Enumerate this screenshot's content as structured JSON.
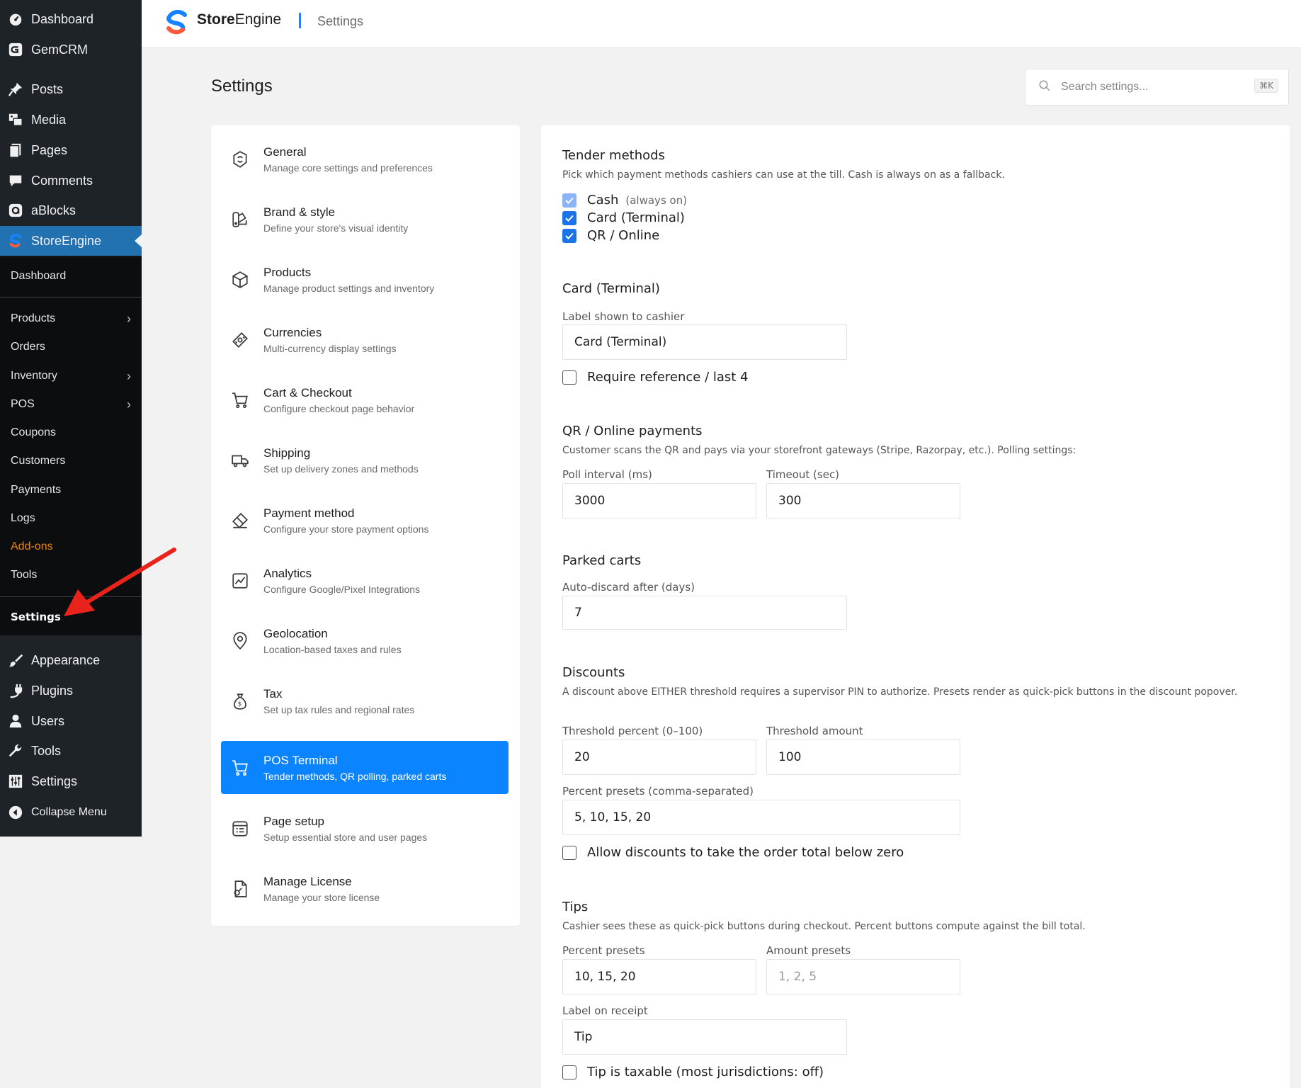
{
  "wp_menu": {
    "items": [
      {
        "label": "Dashboard",
        "icon": "dashboard-icon"
      },
      {
        "label": "GemCRM",
        "icon": "gemcrm-icon"
      },
      {
        "label": "Posts",
        "icon": "pin-icon"
      },
      {
        "label": "Media",
        "icon": "media-icon"
      },
      {
        "label": "Pages",
        "icon": "pages-icon"
      },
      {
        "label": "Comments",
        "icon": "comments-icon"
      },
      {
        "label": "aBlocks",
        "icon": "ablocks-icon"
      },
      {
        "label": "StoreEngine",
        "icon": "storeengine-icon"
      }
    ],
    "storeengine_submenu": [
      {
        "label": "Dashboard",
        "has_arrow": false
      },
      {
        "label": "Products",
        "has_arrow": true
      },
      {
        "label": "Orders",
        "has_arrow": false
      },
      {
        "label": "Inventory",
        "has_arrow": true
      },
      {
        "label": "POS",
        "has_arrow": true
      },
      {
        "label": "Coupons",
        "has_arrow": false
      },
      {
        "label": "Customers",
        "has_arrow": false
      },
      {
        "label": "Payments",
        "has_arrow": false
      },
      {
        "label": "Logs",
        "has_arrow": false
      },
      {
        "label": "Add-ons",
        "has_arrow": false,
        "color": "#f18500"
      },
      {
        "label": "Tools",
        "has_arrow": false
      },
      {
        "label": "Settings",
        "has_arrow": false,
        "active": true
      }
    ],
    "bottom_items": [
      {
        "label": "Appearance",
        "icon": "brush-icon"
      },
      {
        "label": "Plugins",
        "icon": "plugin-icon"
      },
      {
        "label": "Users",
        "icon": "users-icon"
      },
      {
        "label": "Tools",
        "icon": "wrench-icon"
      },
      {
        "label": "Settings",
        "icon": "settings-sliders-icon"
      },
      {
        "label": "Collapse Menu",
        "icon": "collapse-icon"
      }
    ]
  },
  "header": {
    "brand_bold": "Store",
    "brand_rest": "Engine",
    "breadcrumb": "Settings"
  },
  "page": {
    "title": "Settings",
    "search_placeholder": "Search settings...",
    "search_shortcut": "⌘K"
  },
  "settings_nav": [
    {
      "title": "General",
      "desc": "Manage core settings and preferences",
      "icon": "general-icon"
    },
    {
      "title": "Brand & style",
      "desc": "Define your store's visual identity",
      "icon": "brand-style-icon"
    },
    {
      "title": "Products",
      "desc": "Manage product settings and inventory",
      "icon": "box-icon"
    },
    {
      "title": "Currencies",
      "desc": "Multi-currency display settings",
      "icon": "currency-icon"
    },
    {
      "title": "Cart & Checkout",
      "desc": "Configure checkout page behavior",
      "icon": "cart-icon"
    },
    {
      "title": "Shipping",
      "desc": "Set up delivery zones and methods",
      "icon": "truck-icon"
    },
    {
      "title": "Payment method",
      "desc": "Configure your store payment options",
      "icon": "payment-icon"
    },
    {
      "title": "Analytics",
      "desc": "Configure Google/Pixel Integrations",
      "icon": "analytics-icon"
    },
    {
      "title": "Geolocation",
      "desc": "Location-based taxes and rules",
      "icon": "location-pin-icon"
    },
    {
      "title": "Tax",
      "desc": "Set up tax rules and regional rates",
      "icon": "money-bag-icon"
    },
    {
      "title": "POS Terminal",
      "desc": "Tender methods, QR polling, parked carts",
      "icon": "pos-cart-icon",
      "active": true
    },
    {
      "title": "Page setup",
      "desc": "Setup essential store and user pages",
      "icon": "page-setup-icon"
    },
    {
      "title": "Manage License",
      "desc": "Manage your store license",
      "icon": "license-icon"
    }
  ],
  "content": {
    "tender": {
      "title": "Tender methods",
      "desc": "Pick which payment methods cashiers can use at the till. Cash is always on as a fallback.",
      "options": [
        {
          "label": "Cash",
          "hint": "(always on)",
          "checked": true,
          "disabled": true
        },
        {
          "label": "Card (Terminal)",
          "hint": "",
          "checked": true,
          "disabled": false
        },
        {
          "label": "QR / Online",
          "hint": "",
          "checked": true,
          "disabled": false
        }
      ]
    },
    "card": {
      "title": "Card (Terminal)",
      "label_caption": "Label shown to cashier",
      "label_value": "Card (Terminal)",
      "require_ref_label": "Require reference / last 4",
      "require_ref_checked": false
    },
    "qr": {
      "title": "QR / Online payments",
      "desc": "Customer scans the QR and pays via your storefront gateways (Stripe, Razorpay, etc.). Polling settings:",
      "poll_label": "Poll interval (ms)",
      "poll_value": "3000",
      "timeout_label": "Timeout (sec)",
      "timeout_value": "300"
    },
    "parked": {
      "title": "Parked carts",
      "discard_label": "Auto-discard after (days)",
      "discard_value": "7"
    },
    "discounts": {
      "title": "Discounts",
      "desc": "A discount above EITHER threshold requires a supervisor PIN to authorize. Presets render as quick-pick buttons in the discount popover.",
      "threshold_pct_label": "Threshold percent (0–100)",
      "threshold_pct_value": "20",
      "threshold_amt_label": "Threshold amount",
      "threshold_amt_value": "100",
      "presets_label": "Percent presets (comma-separated)",
      "presets_value": "5, 10, 15, 20",
      "allow_below_zero_label": "Allow discounts to take the order total below zero",
      "allow_below_zero_checked": false
    },
    "tips": {
      "title": "Tips",
      "desc": "Cashier sees these as quick-pick buttons during checkout. Percent buttons compute against the bill total.",
      "pct_presets_label": "Percent presets",
      "pct_presets_value": "10, 15, 20",
      "amt_presets_label": "Amount presets",
      "amt_presets_placeholder": "1, 2, 5",
      "receipt_label": "Label on receipt",
      "receipt_value": "Tip",
      "taxable_label": "Tip is taxable (most jurisdictions: off)",
      "taxable_checked": false
    }
  },
  "colors": {
    "wp_sidebar": "#1d2327",
    "wp_active": "#2271b1",
    "submenu_bg": "#0c0d0e",
    "accent_blue": "#0a84ff",
    "checkbox_blue": "#1a73e8",
    "addon_orange": "#f18500",
    "annotation_red": "#e8231c"
  }
}
